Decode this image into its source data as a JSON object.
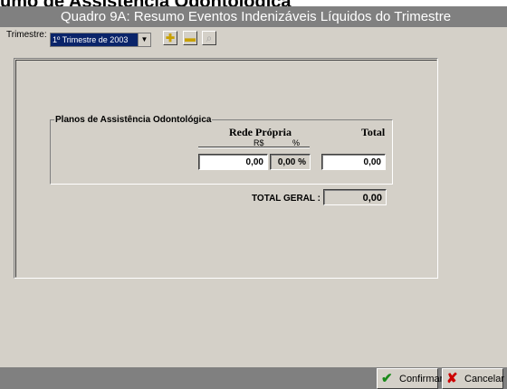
{
  "background_heading": "umo de Assistência Odontológica",
  "window": {
    "title": "Quadro 9A: Resumo Eventos Indenizáveis Líquidos do Trimestre"
  },
  "toolbar": {
    "trimestre_label": "Trimestre:",
    "trimestre_value": "1º Trimestre de 2003",
    "add_icon": "plus-icon",
    "remove_icon": "minus-icon",
    "search_icon": "magnifier-icon"
  },
  "group": {
    "title": "Planos de Assistência Odontológica",
    "rede_propria": "Rede Própria",
    "currency": "R$",
    "percent": "%",
    "total": "Total",
    "rede_value": "0,00",
    "rede_percent": "0,00 %",
    "total_value": "0,00"
  },
  "totals": {
    "label": "TOTAL GERAL :",
    "value": "0,00"
  },
  "buttons": {
    "confirm": "Confirmar",
    "cancel": "Cancelar"
  },
  "colors": {
    "titlebar": "#808080",
    "selection": "#0a246a",
    "confirm_check": "#1a8a1a",
    "cancel_x": "#cc0000"
  }
}
